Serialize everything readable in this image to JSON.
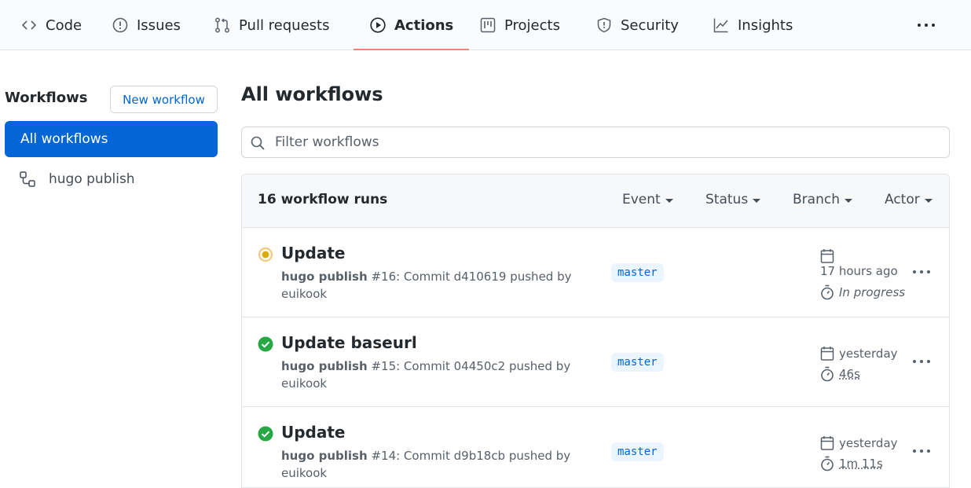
{
  "nav": {
    "tabs": [
      {
        "label": "Code",
        "icon": "code-icon"
      },
      {
        "label": "Issues",
        "icon": "issue-icon"
      },
      {
        "label": "Pull requests",
        "icon": "pull-request-icon"
      },
      {
        "label": "Actions",
        "icon": "play-icon",
        "active": true
      },
      {
        "label": "Projects",
        "icon": "project-icon"
      },
      {
        "label": "Security",
        "icon": "shield-icon"
      },
      {
        "label": "Insights",
        "icon": "graph-icon"
      }
    ]
  },
  "sidebar": {
    "title": "Workflows",
    "new_workflow_label": "New workflow",
    "items": [
      {
        "label": "All workflows",
        "active": true
      },
      {
        "label": "hugo publish",
        "icon": "workflow-icon"
      }
    ]
  },
  "main": {
    "title": "All workflows",
    "filter_placeholder": "Filter workflows",
    "runs_count": "16 workflow runs",
    "filters": [
      "Event",
      "Status",
      "Branch",
      "Actor"
    ],
    "runs": [
      {
        "title": "Update",
        "workflow": "hugo publish",
        "number": "#16",
        "commit_prefix": ": Commit",
        "sha": "d410619",
        "pushed_by": "pushed by",
        "actor": "euikook",
        "branch": "master",
        "when": "17 hours ago",
        "duration": "In progress",
        "status": "in-progress"
      },
      {
        "title": "Update baseurl",
        "workflow": "hugo publish",
        "number": "#15",
        "commit_prefix": ": Commit",
        "sha": "04450c2",
        "pushed_by": "pushed by",
        "actor": "euikook",
        "branch": "master",
        "when": "yesterday",
        "duration": "46s",
        "status": "success"
      },
      {
        "title": "Update",
        "workflow": "hugo publish",
        "number": "#14",
        "commit_prefix": ": Commit",
        "sha": "d9b18cb",
        "pushed_by": "pushed by",
        "actor": "euikook",
        "branch": "master",
        "when": "yesterday",
        "duration": "1m 11s",
        "status": "success"
      }
    ]
  },
  "colors": {
    "accent": "#0366d6",
    "active_tab_underline": "#f9826c",
    "success": "#28a745",
    "in_progress": "#dbab09"
  }
}
